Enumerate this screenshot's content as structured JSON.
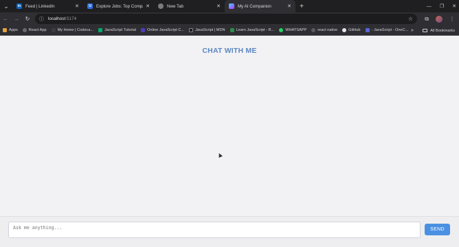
{
  "browser": {
    "tabs": [
      {
        "title": "Feed | LinkedIn",
        "icon": "linkedin-icon",
        "favicon_text": "in",
        "color": "#0a66c2"
      },
      {
        "title": "Explore Jobs: Top Companies A",
        "icon": "jobs-site-icon",
        "favicon_text": "U",
        "color": "#2f6fdc"
      },
      {
        "title": "New Tab",
        "icon": "chrome-icon",
        "favicon_text": "",
        "color": "#7a7a80"
      },
      {
        "title": "My AI Companion",
        "icon": "vite-icon",
        "favicon_text": "",
        "color": "#9b5de5"
      }
    ],
    "address": {
      "host": "localhost",
      "port": ":5174"
    },
    "bookmarks": [
      {
        "label": "Apps",
        "icon": "apps-grid-icon",
        "color": "#e6a23c"
      },
      {
        "label": "React App",
        "icon": "globe-icon",
        "color": "#6a6a70"
      },
      {
        "label": "My Home | Codeca...",
        "icon": "codecademy-icon",
        "color": "#3b3b40"
      },
      {
        "label": "JavaScript Tutorial",
        "icon": "w3schools-icon",
        "color": "#04aa6d"
      },
      {
        "label": "Online JavaScript C...",
        "icon": "programiz-icon",
        "color": "#4b3fb5"
      },
      {
        "label": "JavaScript | MDN",
        "icon": "mdn-icon",
        "color": "#1b1b1b"
      },
      {
        "label": "Learn JavaScript - R...",
        "icon": "learn-icon",
        "color": "#2c8c4a"
      },
      {
        "label": "WHATSAPP",
        "icon": "whatsapp-icon",
        "color": "#25d366"
      },
      {
        "label": "react native",
        "icon": "globe-icon",
        "color": "#5a5a60"
      },
      {
        "label": "GitHub",
        "icon": "github-icon",
        "color": "#e6e6ea"
      },
      {
        "label": "- JavaScript - OneC...",
        "icon": "onecompiler-icon",
        "color": "#5a67d8"
      }
    ],
    "all_bookmarks_label": "All Bookmarks"
  },
  "app": {
    "title": "CHAT WITH ME",
    "input_placeholder": "Ask me anything...",
    "send_label": "SEND",
    "accent_color": "#4a90e2"
  }
}
